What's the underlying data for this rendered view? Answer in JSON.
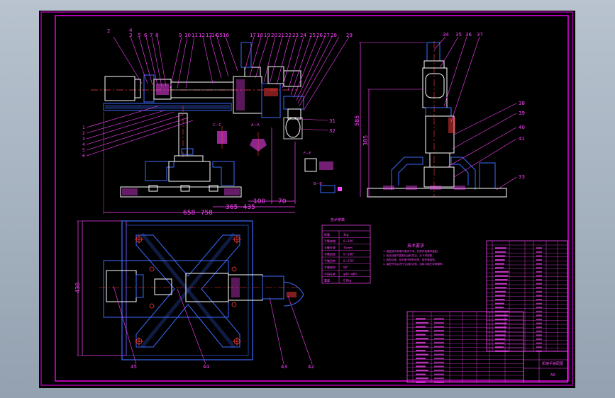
{
  "colors": {
    "viewport_bg": "#a5b2c0",
    "sheet_bg": "#000000",
    "frame": "#ff00ff",
    "blue": "#3b6cff",
    "white": "#ffffff",
    "red": "#ff3b3b",
    "cyan": "#00e0ff",
    "yellow": "#ffff44",
    "green": "#33ff33"
  },
  "balloons_top": [
    "2",
    "4",
    "3",
    "5",
    "6",
    "7",
    "8",
    "9",
    "10",
    "11",
    "12",
    "13",
    "14",
    "15",
    "16",
    "17",
    "18",
    "19",
    "20",
    "21",
    "22",
    "23",
    "24",
    "25",
    "26",
    "27",
    "28",
    "29"
  ],
  "balloons_top_right": [
    "34",
    "35",
    "36",
    "37"
  ],
  "balloons_right_side": [
    "38",
    "39",
    "40",
    "41",
    "33"
  ],
  "balloons_left_side": [
    "1",
    "2",
    "3",
    "4",
    "5",
    "6"
  ],
  "balloons_mid": [
    "31",
    "32"
  ],
  "balloons_bottom": [
    "45",
    "44",
    "43",
    "42"
  ],
  "dimensions": {
    "d_658_758": "658~758",
    "d_365_435": "365~435",
    "d_100": "100",
    "d_70": "70",
    "d_585": "585",
    "d_385": "385",
    "d_430": "430"
  },
  "section_labels": {
    "c_c": "C—C",
    "a_a": "A—A",
    "f_f": "F—F",
    "b_b": "B—B"
  },
  "spec_table": {
    "title": "技术参数",
    "rows": [
      {
        "k": "抓重",
        "v": "3kg"
      },
      {
        "k": "手臂伸缩",
        "v": "0~200"
      },
      {
        "k": "手臂升降",
        "v": "75mm"
      },
      {
        "k": "手臂回转",
        "v": "0~180°"
      },
      {
        "k": "手腕回转",
        "v": "0~270°"
      },
      {
        "k": "手腕俯仰",
        "v": "90°"
      },
      {
        "k": "手指夹紧",
        "v": "φ40~φ60"
      },
      {
        "k": "重量",
        "v": "0.8kg"
      }
    ]
  },
  "tech_req": {
    "title": "技术要求",
    "lines": [
      "1. 装配前所有零件清洗干净，外购件按要求装配。",
      "2. 各运动部件装配后运转灵活，无卡滞现象。",
      "3. 各配合面、密封面不得有划伤、碰伤等缺陷。",
      "4. 装配完毕后进行空运转试验，运转平稳无异常噪声。"
    ]
  },
  "title_block": {
    "name": "机械手装配图",
    "sheet": "A0"
  }
}
